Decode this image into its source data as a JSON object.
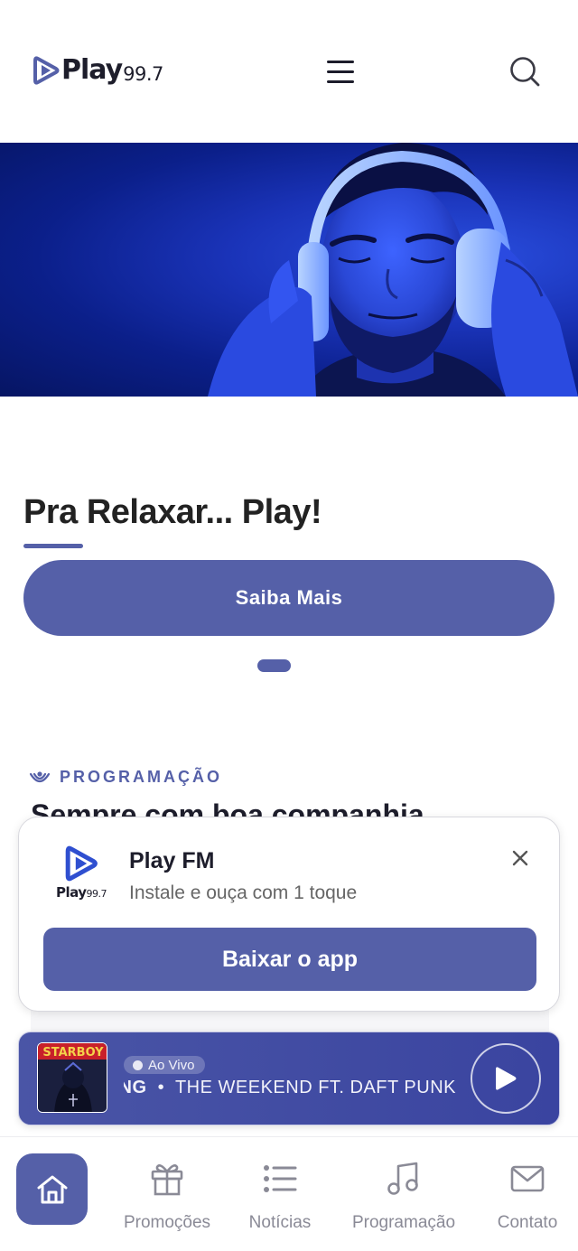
{
  "header": {
    "logo_word": "Play",
    "logo_number": "99.7"
  },
  "hero": {
    "title": "Pra Relaxar... Play!",
    "cta_label": "Saiba Mais"
  },
  "programacao": {
    "label": "PROGRAMAÇÃO",
    "title": "Sempre com boa companhia"
  },
  "app_banner": {
    "logo_word": "Play",
    "logo_number": "99.7",
    "app_name": "Play FM",
    "subtitle": "Instale e ouça com 1 toque",
    "cta_label": "Baixar o app"
  },
  "player": {
    "album_text": "STARBOY",
    "live_label": "Ao Vivo",
    "ticker_song": "NG",
    "ticker_separator": "•",
    "ticker_artist": "THE WEEKEND FT. DAFT PUNK"
  },
  "bottom_nav": {
    "items": [
      {
        "label": "Promoções",
        "icon": "gift-icon"
      },
      {
        "label": "Notícias",
        "icon": "list-icon"
      },
      {
        "label": "Programação",
        "icon": "music-note-icon"
      },
      {
        "label": "Contato",
        "icon": "mail-icon"
      }
    ],
    "home_icon": "home-icon"
  },
  "colors": {
    "accent": "#5560a8",
    "hero_blue": "#1a33b8",
    "text_dark": "#1d1d2b",
    "nav_gray": "#8a8a96"
  }
}
